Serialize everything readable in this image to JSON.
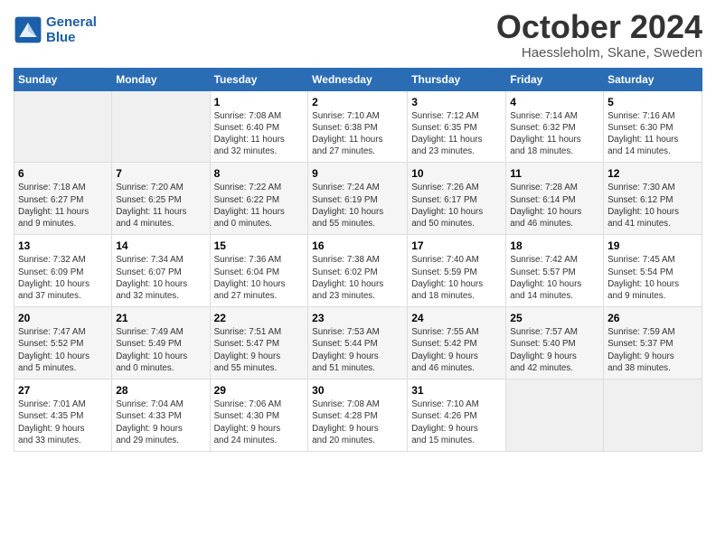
{
  "header": {
    "logo_line1": "General",
    "logo_line2": "Blue",
    "month": "October 2024",
    "location": "Haessleholm, Skane, Sweden"
  },
  "weekdays": [
    "Sunday",
    "Monday",
    "Tuesday",
    "Wednesday",
    "Thursday",
    "Friday",
    "Saturday"
  ],
  "weeks": [
    [
      {
        "day": "",
        "info": ""
      },
      {
        "day": "",
        "info": ""
      },
      {
        "day": "1",
        "info": "Sunrise: 7:08 AM\nSunset: 6:40 PM\nDaylight: 11 hours\nand 32 minutes."
      },
      {
        "day": "2",
        "info": "Sunrise: 7:10 AM\nSunset: 6:38 PM\nDaylight: 11 hours\nand 27 minutes."
      },
      {
        "day": "3",
        "info": "Sunrise: 7:12 AM\nSunset: 6:35 PM\nDaylight: 11 hours\nand 23 minutes."
      },
      {
        "day": "4",
        "info": "Sunrise: 7:14 AM\nSunset: 6:32 PM\nDaylight: 11 hours\nand 18 minutes."
      },
      {
        "day": "5",
        "info": "Sunrise: 7:16 AM\nSunset: 6:30 PM\nDaylight: 11 hours\nand 14 minutes."
      }
    ],
    [
      {
        "day": "6",
        "info": "Sunrise: 7:18 AM\nSunset: 6:27 PM\nDaylight: 11 hours\nand 9 minutes."
      },
      {
        "day": "7",
        "info": "Sunrise: 7:20 AM\nSunset: 6:25 PM\nDaylight: 11 hours\nand 4 minutes."
      },
      {
        "day": "8",
        "info": "Sunrise: 7:22 AM\nSunset: 6:22 PM\nDaylight: 11 hours\nand 0 minutes."
      },
      {
        "day": "9",
        "info": "Sunrise: 7:24 AM\nSunset: 6:19 PM\nDaylight: 10 hours\nand 55 minutes."
      },
      {
        "day": "10",
        "info": "Sunrise: 7:26 AM\nSunset: 6:17 PM\nDaylight: 10 hours\nand 50 minutes."
      },
      {
        "day": "11",
        "info": "Sunrise: 7:28 AM\nSunset: 6:14 PM\nDaylight: 10 hours\nand 46 minutes."
      },
      {
        "day": "12",
        "info": "Sunrise: 7:30 AM\nSunset: 6:12 PM\nDaylight: 10 hours\nand 41 minutes."
      }
    ],
    [
      {
        "day": "13",
        "info": "Sunrise: 7:32 AM\nSunset: 6:09 PM\nDaylight: 10 hours\nand 37 minutes."
      },
      {
        "day": "14",
        "info": "Sunrise: 7:34 AM\nSunset: 6:07 PM\nDaylight: 10 hours\nand 32 minutes."
      },
      {
        "day": "15",
        "info": "Sunrise: 7:36 AM\nSunset: 6:04 PM\nDaylight: 10 hours\nand 27 minutes."
      },
      {
        "day": "16",
        "info": "Sunrise: 7:38 AM\nSunset: 6:02 PM\nDaylight: 10 hours\nand 23 minutes."
      },
      {
        "day": "17",
        "info": "Sunrise: 7:40 AM\nSunset: 5:59 PM\nDaylight: 10 hours\nand 18 minutes."
      },
      {
        "day": "18",
        "info": "Sunrise: 7:42 AM\nSunset: 5:57 PM\nDaylight: 10 hours\nand 14 minutes."
      },
      {
        "day": "19",
        "info": "Sunrise: 7:45 AM\nSunset: 5:54 PM\nDaylight: 10 hours\nand 9 minutes."
      }
    ],
    [
      {
        "day": "20",
        "info": "Sunrise: 7:47 AM\nSunset: 5:52 PM\nDaylight: 10 hours\nand 5 minutes."
      },
      {
        "day": "21",
        "info": "Sunrise: 7:49 AM\nSunset: 5:49 PM\nDaylight: 10 hours\nand 0 minutes."
      },
      {
        "day": "22",
        "info": "Sunrise: 7:51 AM\nSunset: 5:47 PM\nDaylight: 9 hours\nand 55 minutes."
      },
      {
        "day": "23",
        "info": "Sunrise: 7:53 AM\nSunset: 5:44 PM\nDaylight: 9 hours\nand 51 minutes."
      },
      {
        "day": "24",
        "info": "Sunrise: 7:55 AM\nSunset: 5:42 PM\nDaylight: 9 hours\nand 46 minutes."
      },
      {
        "day": "25",
        "info": "Sunrise: 7:57 AM\nSunset: 5:40 PM\nDaylight: 9 hours\nand 42 minutes."
      },
      {
        "day": "26",
        "info": "Sunrise: 7:59 AM\nSunset: 5:37 PM\nDaylight: 9 hours\nand 38 minutes."
      }
    ],
    [
      {
        "day": "27",
        "info": "Sunrise: 7:01 AM\nSunset: 4:35 PM\nDaylight: 9 hours\nand 33 minutes."
      },
      {
        "day": "28",
        "info": "Sunrise: 7:04 AM\nSunset: 4:33 PM\nDaylight: 9 hours\nand 29 minutes."
      },
      {
        "day": "29",
        "info": "Sunrise: 7:06 AM\nSunset: 4:30 PM\nDaylight: 9 hours\nand 24 minutes."
      },
      {
        "day": "30",
        "info": "Sunrise: 7:08 AM\nSunset: 4:28 PM\nDaylight: 9 hours\nand 20 minutes."
      },
      {
        "day": "31",
        "info": "Sunrise: 7:10 AM\nSunset: 4:26 PM\nDaylight: 9 hours\nand 15 minutes."
      },
      {
        "day": "",
        "info": ""
      },
      {
        "day": "",
        "info": ""
      }
    ]
  ]
}
